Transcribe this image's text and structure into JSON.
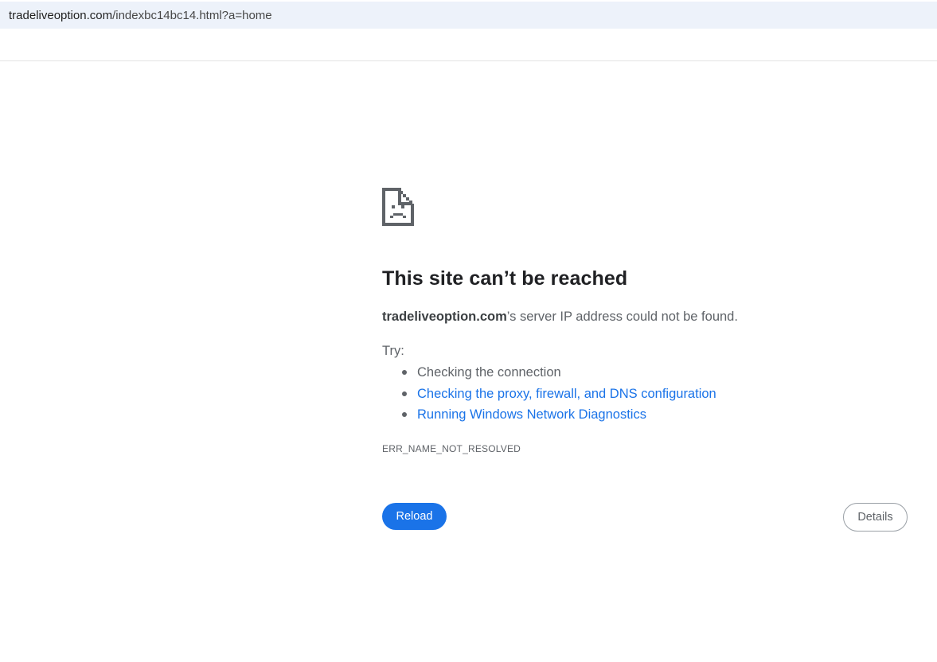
{
  "address_bar": {
    "host": "tradeliveoption.com",
    "path": "/indexbc14bc14.html?a=home"
  },
  "error_page": {
    "icon": "sad-page-icon",
    "heading": "This site can’t be reached",
    "summary_host": "tradeliveoption.com",
    "summary_rest": "’s server IP address could not be found.",
    "try_label": "Try:",
    "suggestions": [
      {
        "label": "Checking the connection",
        "is_link": false
      },
      {
        "label": "Checking the proxy, firewall, and DNS configuration",
        "is_link": true
      },
      {
        "label": "Running Windows Network Diagnostics",
        "is_link": true
      }
    ],
    "error_code": "ERR_NAME_NOT_RESOLVED",
    "reload_label": "Reload",
    "details_label": "Details"
  },
  "colors": {
    "accent": "#1a73e8",
    "text_primary": "#202124",
    "text_secondary": "#5f6368",
    "address_bar_bg": "#edf2fa"
  }
}
